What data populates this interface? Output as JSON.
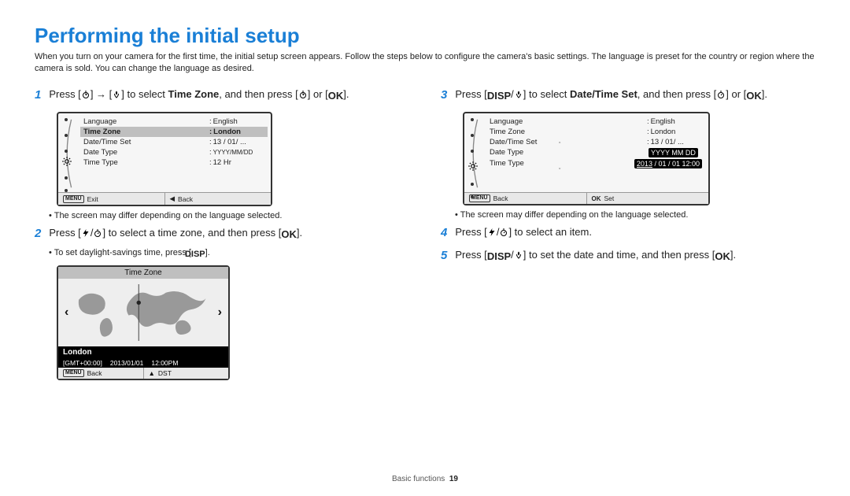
{
  "title": "Performing the initial setup",
  "intro": "When you turn on your camera for the first time, the initial setup screen appears. Follow the steps below to configure the camera's basic settings. The language is preset for the country or region where the camera is sold. You can change the language as desired.",
  "labels": {
    "timer": "timer-icon",
    "macro": "macro-icon",
    "ok": "OK",
    "disp": "DISP",
    "flash": "flash-icon",
    "menu": "MENU"
  },
  "steps": {
    "s1_a": "Press [",
    "s1_b": "] → [",
    "s1_c": "] to select ",
    "s1_bold": "Time Zone",
    "s1_d": ", and then press [",
    "s1_e": "] or [",
    "s1_f": "].",
    "s1_note": "The screen may differ depending on the language selected.",
    "s2_a": "Press [",
    "s2_b": "] to select a time zone, and then press [",
    "s2_c": "].",
    "s2_note": "To set daylight-savings time, press [",
    "s2_note_end": "].",
    "s3_a": "Press [",
    "s3_b": "] to select ",
    "s3_bold": "Date/Time Set",
    "s3_c": ", and then press [",
    "s3_d": "] or [",
    "s3_e": "].",
    "s3_note": "The screen may differ depending on the language selected.",
    "s4_a": "Press [",
    "s4_b": "] to select an item.",
    "s5_a": "Press [",
    "s5_b": "] to set the date and time, and then press [",
    "s5_c": "]."
  },
  "screen1": {
    "rows": [
      {
        "label": "Language",
        "val": "English",
        "sel": false
      },
      {
        "label": "Time Zone",
        "val": "London",
        "sel": true
      },
      {
        "label": "Date/Time Set",
        "val": "13 / 01/ ...",
        "sel": false
      },
      {
        "label": "Date Type",
        "val": "YYYY/MM/DD",
        "sel": false
      },
      {
        "label": "Time Type",
        "val": "12 Hr",
        "sel": false
      }
    ],
    "footer_left": "Exit",
    "footer_right": "Back"
  },
  "screen2": {
    "rows": [
      {
        "label": "Language",
        "val": "English",
        "sel": false
      },
      {
        "label": "Time Zone",
        "val": "London",
        "sel": false
      },
      {
        "label": "Date/Time Set",
        "val": "13 / 01/ ...",
        "sel": true
      },
      {
        "label": "Date Type",
        "val_popup_head": "YYYY  MM  DD",
        "sel": false
      },
      {
        "label": "Time Type",
        "val_popup_body": "2013 / 01 / 01 12:00",
        "year": "2013",
        "sel": false
      }
    ],
    "footer_left": "Back",
    "footer_right": "Set"
  },
  "tz": {
    "title": "Time Zone",
    "city": "London",
    "gmt": "[GMT+00:00]",
    "date": "2013/01/01",
    "time": "12:00PM",
    "footer_left": "Back",
    "footer_right": "DST"
  },
  "footer": {
    "section": "Basic functions",
    "page": "19"
  }
}
